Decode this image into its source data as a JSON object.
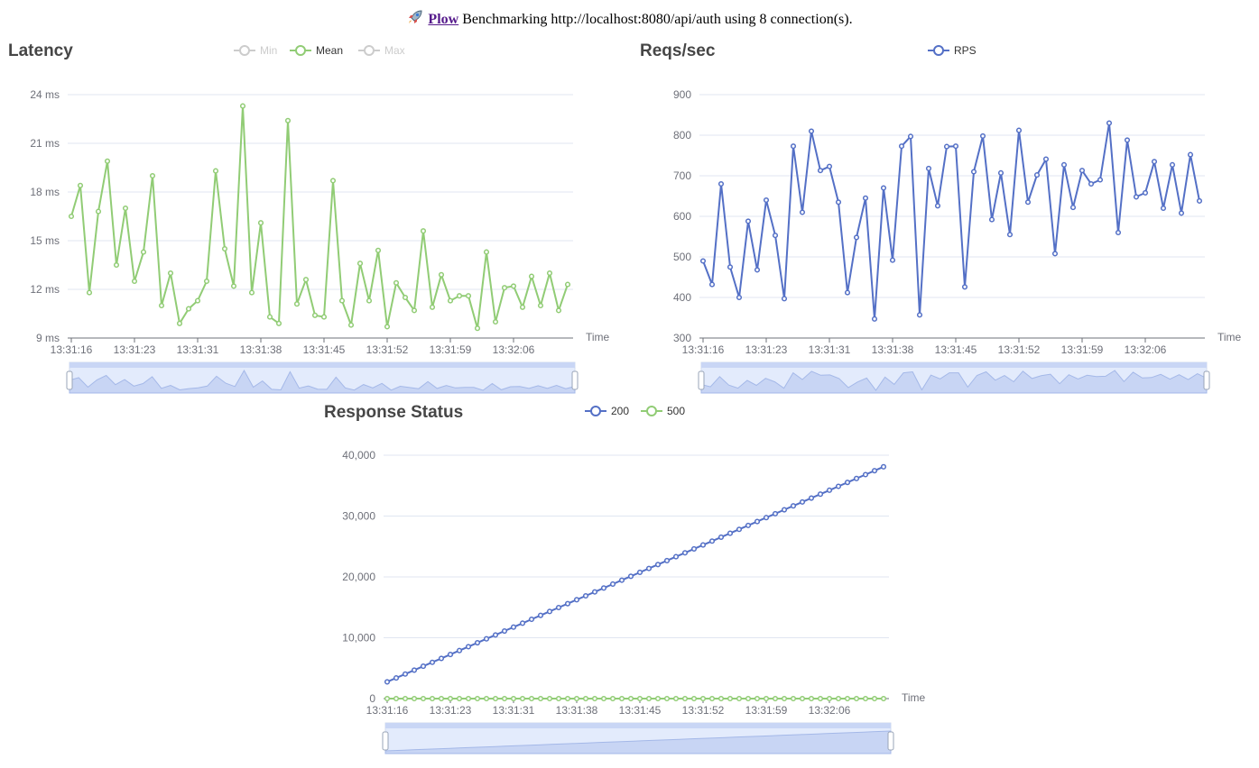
{
  "header": {
    "icon": "rocket-icon",
    "link_text": "Plow",
    "text": "Benchmarking http://localhost:8080/api/auth using 8 connection(s)."
  },
  "colors": {
    "green": "#91cc75",
    "blue": "#5470c6",
    "inactive": "#cccccc",
    "axis": "#6e7079",
    "grid": "#e0e6f1"
  },
  "chart_data": [
    {
      "id": "latency",
      "type": "line",
      "title": "Latency",
      "xlabel": "Time",
      "ylabel": "",
      "yunit": "ms",
      "ylim": [
        9,
        24
      ],
      "yticks": [
        9,
        12,
        15,
        18,
        21,
        24
      ],
      "ytick_labels": [
        "9 ms",
        "12 ms",
        "15 ms",
        "18 ms",
        "21 ms",
        "24 ms"
      ],
      "xtick_labels": [
        "13:31:16",
        "13:31:23",
        "13:31:31",
        "13:31:38",
        "13:31:45",
        "13:31:52",
        "13:31:59",
        "13:32:06"
      ],
      "x_range": [
        "13:31:16",
        "13:32:11"
      ],
      "legend": [
        {
          "name": "Min",
          "active": false
        },
        {
          "name": "Mean",
          "active": true
        },
        {
          "name": "Max",
          "active": false
        }
      ],
      "series": [
        {
          "name": "Mean",
          "values": [
            16.5,
            18.4,
            11.8,
            16.8,
            19.9,
            13.5,
            17.0,
            12.5,
            14.3,
            19.0,
            11.0,
            13.0,
            9.9,
            10.8,
            11.3,
            12.5,
            19.3,
            14.5,
            12.2,
            23.3,
            11.8,
            16.1,
            10.3,
            9.9,
            22.4,
            11.1,
            12.6,
            10.4,
            10.3,
            18.7,
            11.3,
            9.8,
            13.6,
            11.3,
            14.4,
            9.7,
            12.4,
            11.5,
            10.7,
            15.6,
            10.9,
            12.9,
            11.3,
            11.6,
            11.6,
            9.6,
            14.3,
            10.0,
            12.1,
            12.2,
            10.9,
            12.8,
            11.0,
            13.0,
            10.7,
            12.3
          ]
        }
      ]
    },
    {
      "id": "rps",
      "type": "line",
      "title": "Reqs/sec",
      "xlabel": "Time",
      "ylabel": "",
      "ylim": [
        300,
        900
      ],
      "yticks": [
        300,
        400,
        500,
        600,
        700,
        800,
        900
      ],
      "ytick_labels": [
        "300",
        "400",
        "500",
        "600",
        "700",
        "800",
        "900"
      ],
      "xtick_labels": [
        "13:31:16",
        "13:31:23",
        "13:31:31",
        "13:31:38",
        "13:31:45",
        "13:31:52",
        "13:31:59",
        "13:32:06"
      ],
      "x_range": [
        "13:31:16",
        "13:32:11"
      ],
      "legend": [
        {
          "name": "RPS",
          "active": true
        }
      ],
      "series": [
        {
          "name": "RPS",
          "values": [
            490,
            432,
            680,
            475,
            400,
            588,
            468,
            640,
            553,
            397,
            773,
            610,
            810,
            713,
            723,
            635,
            412,
            548,
            645,
            347,
            670,
            492,
            773,
            797,
            357,
            718,
            626,
            772,
            773,
            426,
            710,
            798,
            592,
            707,
            555,
            812,
            635,
            702,
            741,
            508,
            727,
            622,
            713,
            680,
            690,
            830,
            560,
            788,
            648,
            658,
            735,
            620,
            727,
            608,
            752,
            638
          ]
        }
      ]
    },
    {
      "id": "status",
      "type": "line",
      "title": "Response Status",
      "xlabel": "Time",
      "ylabel": "",
      "ylim": [
        0,
        40000
      ],
      "yticks": [
        0,
        10000,
        20000,
        30000,
        40000
      ],
      "ytick_labels": [
        "0",
        "10,000",
        "20,000",
        "30,000",
        "40,000"
      ],
      "xtick_labels": [
        "13:31:16",
        "13:31:23",
        "13:31:31",
        "13:31:38",
        "13:31:45",
        "13:31:52",
        "13:31:59",
        "13:32:06"
      ],
      "x_range": [
        "13:31:16",
        "13:32:11"
      ],
      "legend": [
        {
          "name": "200",
          "active": true
        },
        {
          "name": "500",
          "active": true
        }
      ],
      "series": [
        {
          "name": "200",
          "linear": {
            "first": 2750,
            "last": 38100
          }
        },
        {
          "name": "500",
          "linear": {
            "first": 0,
            "last": 0
          }
        }
      ]
    }
  ]
}
